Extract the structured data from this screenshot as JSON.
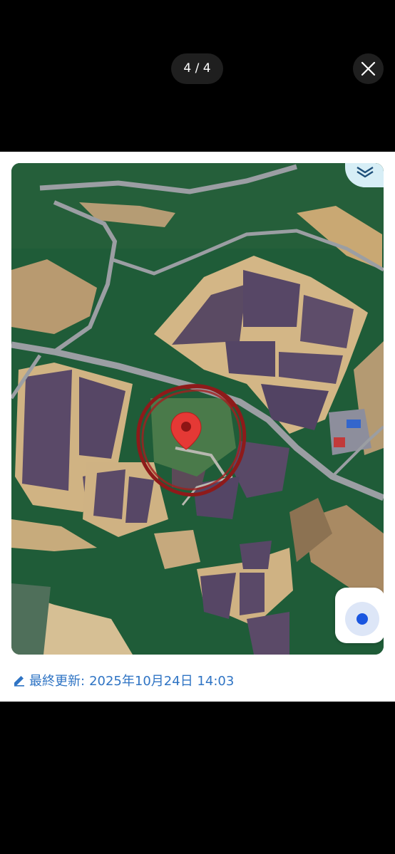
{
  "viewer": {
    "counter": "4 / 4",
    "close_icon": "close-icon"
  },
  "map": {
    "layers_icon": "layers-icon",
    "locate_icon": "my-location-icon",
    "marker_icon": "map-pin-icon",
    "accent_color": "#e53935",
    "locate_color": "#1a56e0"
  },
  "footer": {
    "updated_label": "最終更新:",
    "updated_value": "2025年10月24日 14:03",
    "edit_icon": "pencil-icon",
    "text_color": "#2f74c4"
  }
}
